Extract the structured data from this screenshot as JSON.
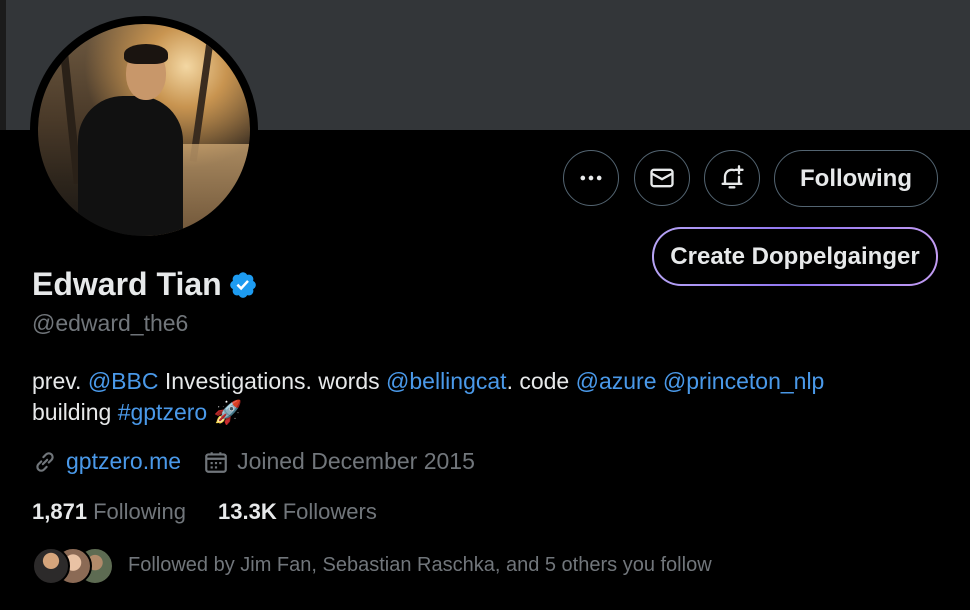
{
  "profile": {
    "name": "Edward Tian",
    "handle": "@edward_the6",
    "bio": {
      "p1": "prev. ",
      "m_bbc": "@BBC",
      "p2": " Investigations. words ",
      "m_bellingcat": "@bellingcat",
      "p3": ". code ",
      "m_azure": "@azure",
      "p4": " ",
      "m_princeton": "@princeton_nlp",
      "p5": "building ",
      "hashtag": "#gptzero",
      "emoji": "🚀"
    },
    "website": "gptzero.me",
    "joined": "Joined December 2015",
    "following_count": "1,871",
    "following_label": "Following",
    "followers_count": "13.3K",
    "followers_label": "Followers",
    "followed_by": "Followed by Jim Fan, Sebastian Raschka, and 5 others you follow"
  },
  "actions": {
    "more_icon": "more-icon",
    "message_icon": "mail-icon",
    "notify_icon": "bell-plus-icon",
    "following_button": "Following",
    "doppel_button": "Create Doppelgainger"
  },
  "colors": {
    "background": "#000000",
    "banner": "#333639",
    "link": "#4a99e9",
    "verified": "#1d9bf0",
    "secondary_text": "#71767b"
  }
}
